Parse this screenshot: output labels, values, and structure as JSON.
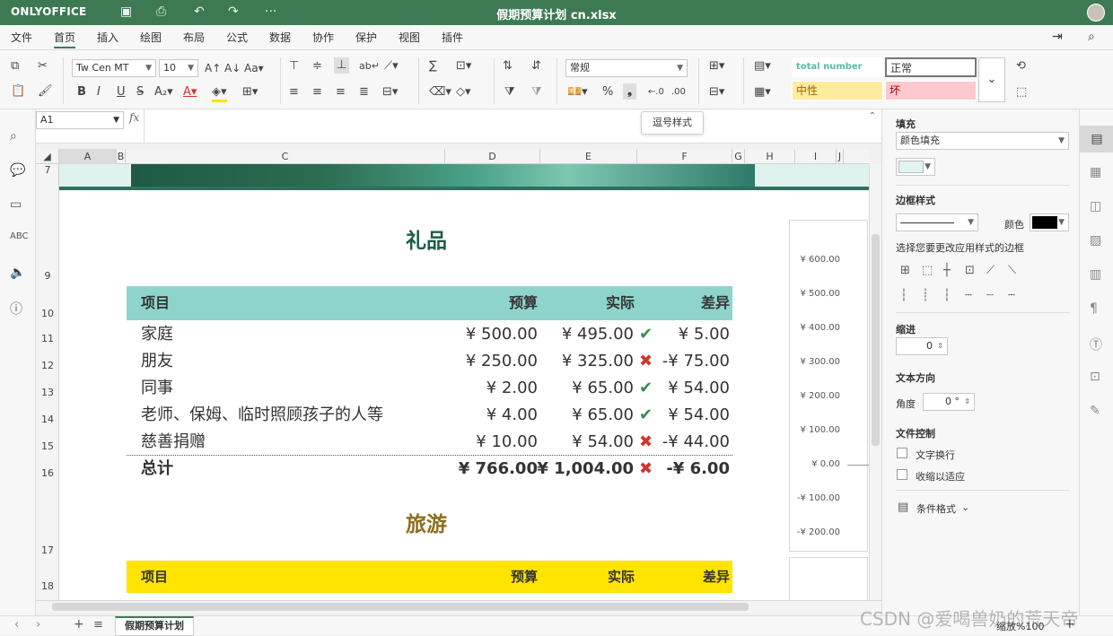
{
  "titlebar": {
    "brand": "ONLYOFFICE",
    "doc_title": "假期预算计划 cn.xlsx",
    "more": "···"
  },
  "menu": [
    "文件",
    "首页",
    "插入",
    "绘图",
    "布局",
    "公式",
    "数据",
    "协作",
    "保护",
    "视图",
    "插件"
  ],
  "toolbar": {
    "font_name": "Tw Cen MT",
    "font_size": "10",
    "number_format": "常规",
    "aa_up": "A↑",
    "aa_down": "A↓",
    "sigma": "∑",
    "percent": "%",
    "styles": {
      "total_number": "total number",
      "normal": "正常",
      "neutral": "中性",
      "bad": "坏"
    }
  },
  "tooltip": "逗号样式",
  "formula": {
    "cell_ref": "A1",
    "fx": "fx"
  },
  "columns": [
    "A",
    "B",
    "C",
    "D",
    "E",
    "F",
    "G",
    "H",
    "I",
    "J"
  ],
  "rows": [
    "7",
    "9",
    "10",
    "11",
    "12",
    "13",
    "14",
    "15",
    "16",
    "17",
    "18"
  ],
  "gifts": {
    "title": "礼品",
    "headers": [
      "项目",
      "预算",
      "实际",
      "差异"
    ],
    "items": [
      {
        "name": "家庭",
        "budget": "¥ 500.00",
        "actual": "¥ 495.00",
        "mark": "✔",
        "diff": "¥ 5.00",
        "ok": true
      },
      {
        "name": "朋友",
        "budget": "¥ 250.00",
        "actual": "¥ 325.00",
        "mark": "✖",
        "diff": "-¥ 75.00",
        "ok": false
      },
      {
        "name": "同事",
        "budget": "¥ 2.00",
        "actual": "¥ 65.00",
        "mark": "✔",
        "diff": "¥ 54.00",
        "ok": true
      },
      {
        "name": "老师、保姆、临时照顾孩子的人等",
        "budget": "¥ 4.00",
        "actual": "¥ 65.00",
        "mark": "✔",
        "diff": "¥ 54.00",
        "ok": true
      },
      {
        "name": "慈善捐赠",
        "budget": "¥ 10.00",
        "actual": "¥ 54.00",
        "mark": "✖",
        "diff": "-¥ 44.00",
        "ok": false
      }
    ],
    "total": {
      "name": "总计",
      "budget": "¥ 766.00",
      "actual": "¥ 1,004.00",
      "mark": "✖",
      "diff": "-¥ 6.00"
    }
  },
  "travel": {
    "title": "旅游",
    "headers": [
      "项目",
      "预算",
      "实际",
      "差异"
    ]
  },
  "chart_ticks": [
    "¥ 600.00",
    "¥ 500.00",
    "¥ 400.00",
    "¥ 300.00",
    "¥ 200.00",
    "¥ 100.00",
    "¥ 0.00",
    "-¥ 100.00",
    "-¥ 200.00"
  ],
  "rightpanel": {
    "fill": "填充",
    "fill_type": "颜色填充",
    "border_style": "边框样式",
    "color": "颜色",
    "border_hint": "选择您要更改应用样式的边框",
    "indent": "缩进",
    "indent_value": "0",
    "text_direction": "文本方向",
    "angle": "角度",
    "angle_value": "0 °",
    "text_control": "文件控制",
    "wrap_text": "文字换行",
    "shrink": "收缩以适应",
    "cond_format": "条件格式"
  },
  "status": {
    "sheet_tab": "假期预算计划",
    "zoom": "缩放%100"
  },
  "watermark": "CSDN @爱喝兽奶的荒天帝"
}
